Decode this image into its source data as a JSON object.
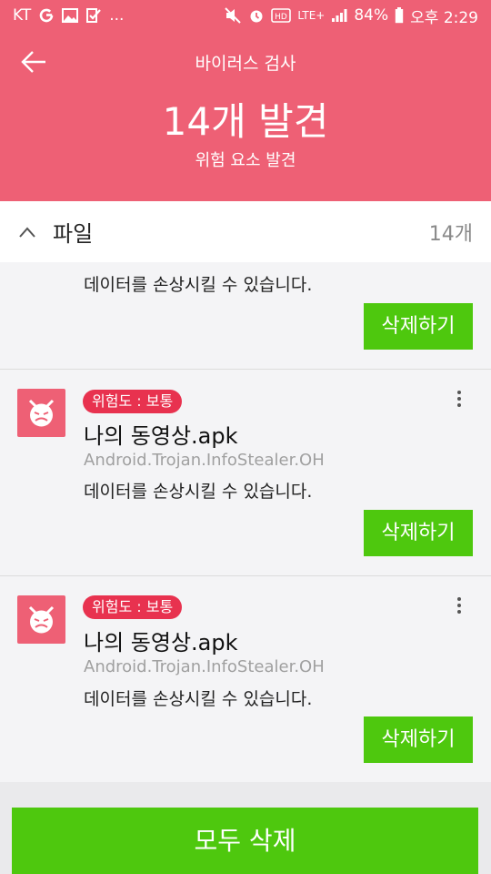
{
  "status_bar": {
    "carrier": "KT",
    "overflow": "...",
    "network": "LTE+",
    "battery": "84%",
    "time": "오후 2:29"
  },
  "header": {
    "title": "바이러스 검사",
    "found": "14개 발견",
    "subtitle": "위험 요소 발견"
  },
  "section": {
    "title": "파일",
    "count": "14개"
  },
  "partial_item": {
    "description": "데이터를 손상시킬 수 있습니다.",
    "delete_label": "삭제하기"
  },
  "items": [
    {
      "badge": "위험도 : 보통",
      "file_name": "나의 동영상.apk",
      "threat": "Android.Trojan.InfoStealer.OH",
      "description": "데이터를 손상시킬 수 있습니다.",
      "delete_label": "삭제하기"
    },
    {
      "badge": "위험도 : 보통",
      "file_name": "나의 동영상.apk",
      "threat": "Android.Trojan.InfoStealer.OH",
      "description": "데이터를 손상시킬 수 있습니다.",
      "delete_label": "삭제하기"
    }
  ],
  "footer": {
    "delete_all": "모두 삭제"
  },
  "colors": {
    "header_bg": "#ee6075",
    "accent_green": "#4ec80e",
    "badge_red": "#e8324f"
  }
}
